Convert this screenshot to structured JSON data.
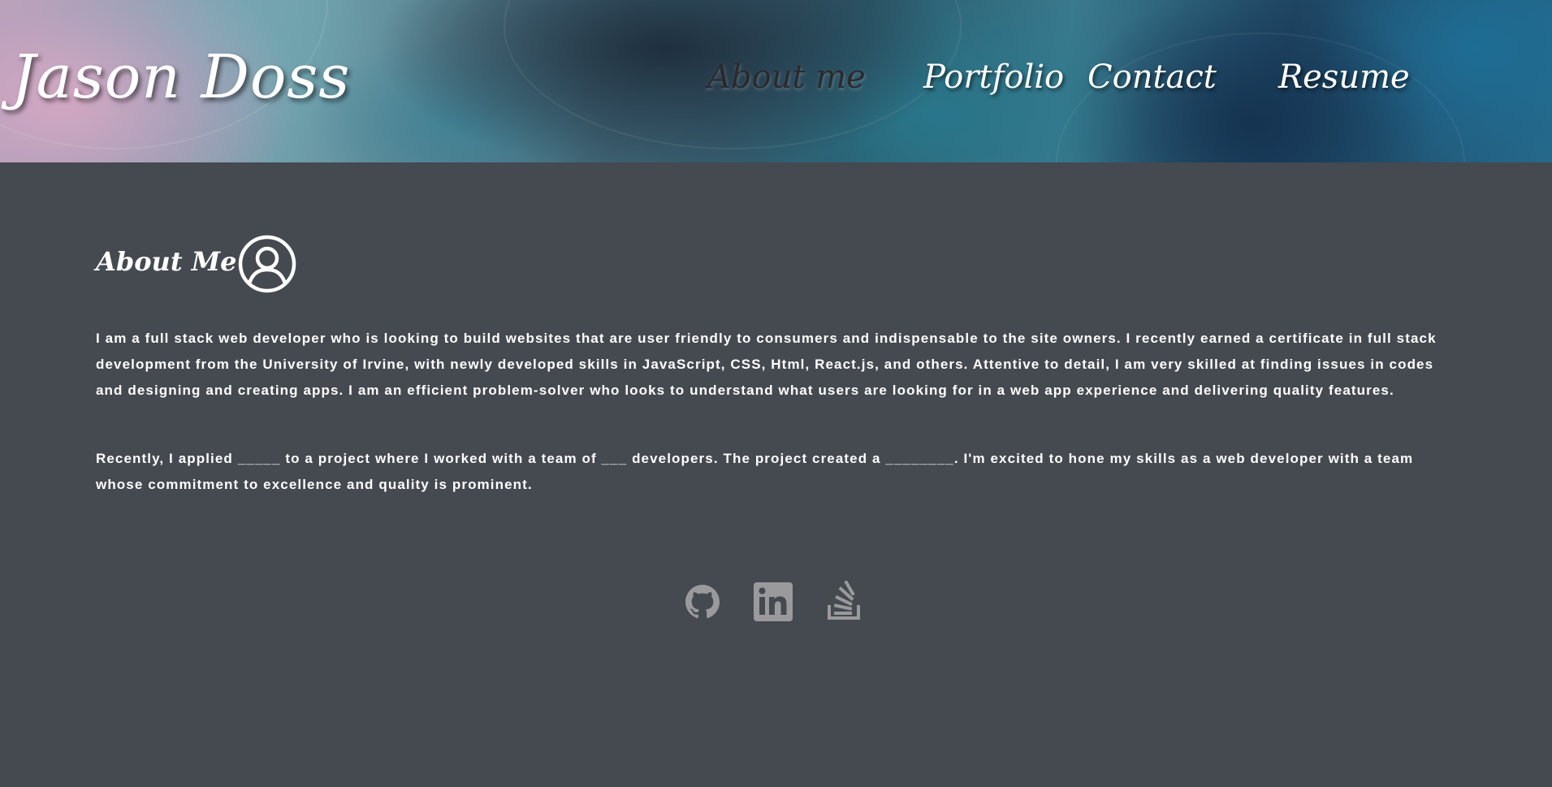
{
  "header": {
    "brand": "Jason Doss",
    "nav": [
      {
        "label": "About me",
        "active": true
      },
      {
        "label": "Portfolio",
        "active": false
      },
      {
        "label": "Contact",
        "active": false
      },
      {
        "label": "Resume",
        "active": false
      }
    ]
  },
  "about": {
    "heading": "About Me",
    "icon": "user-circle-icon",
    "paragraphs": [
      "I am a full stack web developer who is looking to build websites that are user friendly to consumers and indispensable to the site owners. I recently earned a certificate in full stack development from the University of Irvine, with newly developed skills in JavaScript, CSS, Html, React.js, and others. Attentive to detail, I am very skilled at finding issues in codes and designing and creating apps. I am an efficient problem-solver who looks to understand what users are looking for in a web app experience and delivering quality features.",
      "Recently, I applied _____ to a project where I worked with a team of ___ developers. The project created a ________. I'm excited to hone my skills as a web developer with a team whose commitment to excellence and quality is prominent."
    ]
  },
  "social": {
    "icons": [
      "github-icon",
      "linkedin-icon",
      "stackoverflow-icon"
    ],
    "color": "#9a9a9c"
  },
  "colors": {
    "background": "#454950",
    "text": "#ffffff",
    "active_nav": "#2a2a2e"
  }
}
